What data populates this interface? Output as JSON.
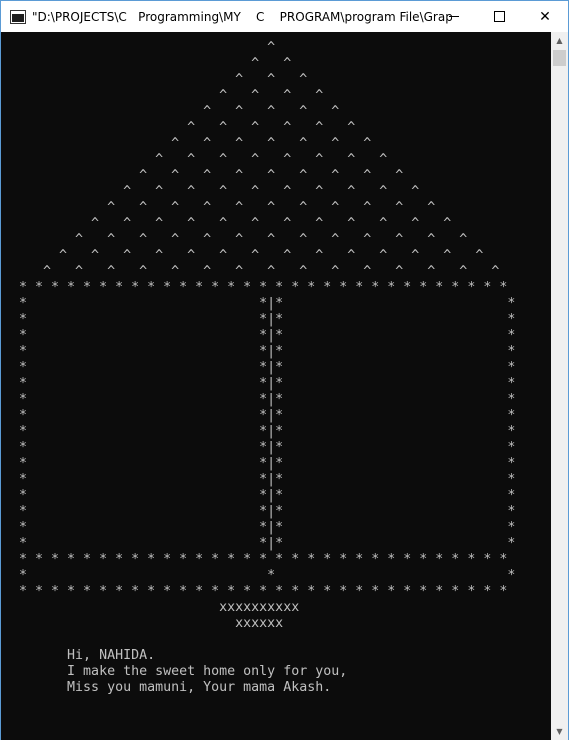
{
  "window": {
    "title": "\"D:\\PROJECTS\\C   Programming\\MY    C    PROGRAM\\program File\\Grap...",
    "icons": {
      "app": "console-app-icon",
      "minimize": "minimize-icon",
      "maximize": "maximize-icon",
      "close": "close-icon",
      "scroll_up": "scroll-up-arrow-icon",
      "scroll_down": "scroll-down-arrow-icon"
    },
    "controls": {
      "close_glyph": "✕",
      "up_glyph": "▲",
      "down_glyph": "▼"
    }
  },
  "console": {
    "background": "#0c0c0c",
    "foreground": "#c0c0c0",
    "lines": [
      "                                 ^",
      "                               ^   ^",
      "                             ^   ^   ^",
      "                           ^   ^   ^   ^",
      "                         ^   ^   ^   ^   ^",
      "                       ^   ^   ^   ^   ^   ^",
      "                     ^   ^   ^   ^   ^   ^   ^",
      "                   ^   ^   ^   ^   ^   ^   ^   ^",
      "                 ^   ^   ^   ^   ^   ^   ^   ^   ^",
      "               ^   ^   ^   ^   ^   ^   ^   ^   ^   ^",
      "             ^   ^   ^   ^   ^   ^   ^   ^   ^   ^   ^",
      "           ^   ^   ^   ^   ^   ^   ^   ^   ^   ^   ^   ^",
      "         ^   ^   ^   ^   ^   ^   ^   ^   ^   ^   ^   ^   ^",
      "       ^   ^   ^   ^   ^   ^   ^   ^   ^   ^   ^   ^   ^   ^",
      "     ^   ^   ^   ^   ^   ^   ^   ^   ^   ^   ^   ^   ^   ^   ^",
      "  * * * * * * * * * * * * * * * * * * * * * * * * * * * * * * *",
      "  *                             *|*                            *",
      "  *                             *|*                            *",
      "  *                             *|*                            *",
      "  *                             *|*                            *",
      "  *                             *|*                            *",
      "  *                             *|*                            *",
      "  *                             *|*                            *",
      "  *                             *|*                            *",
      "  *                             *|*                            *",
      "  *                             *|*                            *",
      "  *                             *|*                            *",
      "  *                             *|*                            *",
      "  *                             *|*                            *",
      "  *                             *|*                            *",
      "  *                             *|*                            *",
      "  *                             *|*                            *",
      "  * * * * * * * * * * * * * * * * * * * * * * * * * * * * * * *",
      "  *                              *                             *",
      "  * * * * * * * * * * * * * * * * * * * * * * * * * * * * * * *",
      "                           xxxxxxxxxx",
      "                             xxxxxx",
      "",
      "        Hi, NAHIDA.",
      "        I make the sweet home only for you,",
      "        Miss you mamuni, Your mama Akash."
    ]
  }
}
